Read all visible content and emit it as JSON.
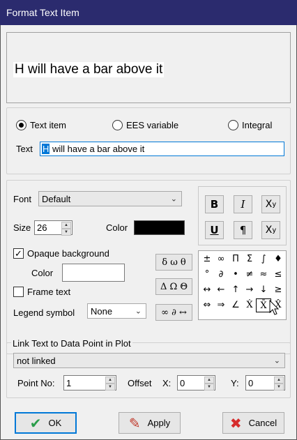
{
  "window": {
    "title": "Format Text Item"
  },
  "preview": {
    "text": "H will have a bar above it"
  },
  "type": {
    "options": [
      {
        "label": "Text item",
        "selected": true
      },
      {
        "label": "EES variable",
        "selected": false
      },
      {
        "label": "Integral",
        "selected": false
      }
    ]
  },
  "text_field": {
    "label": "Text",
    "selected_part": "H",
    "rest": " will have a bar above it"
  },
  "font": {
    "label": "Font",
    "value": "Default"
  },
  "size": {
    "label": "Size",
    "value": "26"
  },
  "color": {
    "label": "Color",
    "swatch": "#000000"
  },
  "opaque": {
    "label": "Opaque background",
    "checked": true,
    "color_label": "Color"
  },
  "frame": {
    "label": "Frame text",
    "checked": false
  },
  "legend": {
    "label": "Legend symbol",
    "value": "None"
  },
  "format_buttons": {
    "bold": "B",
    "italic": "I",
    "subscript_base": "X",
    "subscript": "y",
    "underline": "U",
    "paragraph": "¶",
    "superscript_base": "X",
    "superscript": "y"
  },
  "greek_buttons": [
    "δ ω θ",
    "Δ Ω Θ",
    "∞ ∂ ↔"
  ],
  "symbols": [
    [
      "±",
      "∞",
      "Π",
      "Σ",
      "∫",
      "♦"
    ],
    [
      "°",
      "∂",
      "•",
      "≠",
      "≈",
      "≤"
    ],
    [
      "↔",
      "←",
      "↑",
      "→",
      "↓",
      "≥"
    ],
    [
      "⇔",
      "⇒",
      "∠",
      "Ẋ",
      "X̄",
      "X̂"
    ]
  ],
  "link": {
    "group_label": "Link Text to Data Point in Plot",
    "value": "not linked",
    "point_label": "Point No:",
    "point_value": "1",
    "offset_label": "Offset",
    "x_label": "X:",
    "x_value": "0",
    "y_label": "Y:",
    "y_value": "0"
  },
  "buttons": {
    "ok": "OK",
    "apply": "Apply",
    "cancel": "Cancel"
  }
}
